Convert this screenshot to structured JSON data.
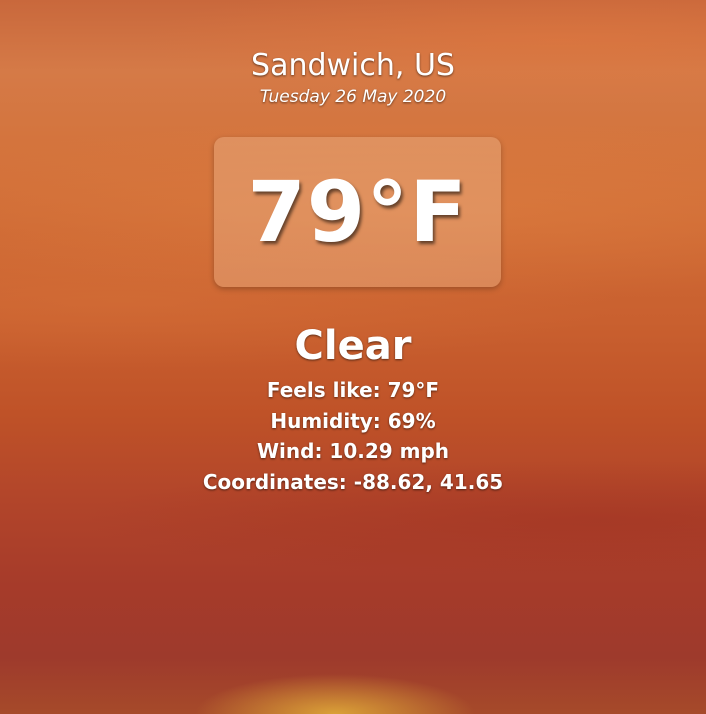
{
  "location": {
    "city": "Sandwich, US",
    "date": "Tuesday 26 May 2020"
  },
  "current": {
    "temperature": "79°F",
    "condition": "Clear",
    "feels_like": "Feels like: 79°F",
    "humidity": "Humidity: 69%",
    "wind": "Wind: 10.29 mph",
    "coordinates": "Coordinates: -88.62, 41.65"
  },
  "colors": {
    "text": "#ffffff",
    "background_top": "#c9683c",
    "background_bottom": "#a63b2a"
  }
}
